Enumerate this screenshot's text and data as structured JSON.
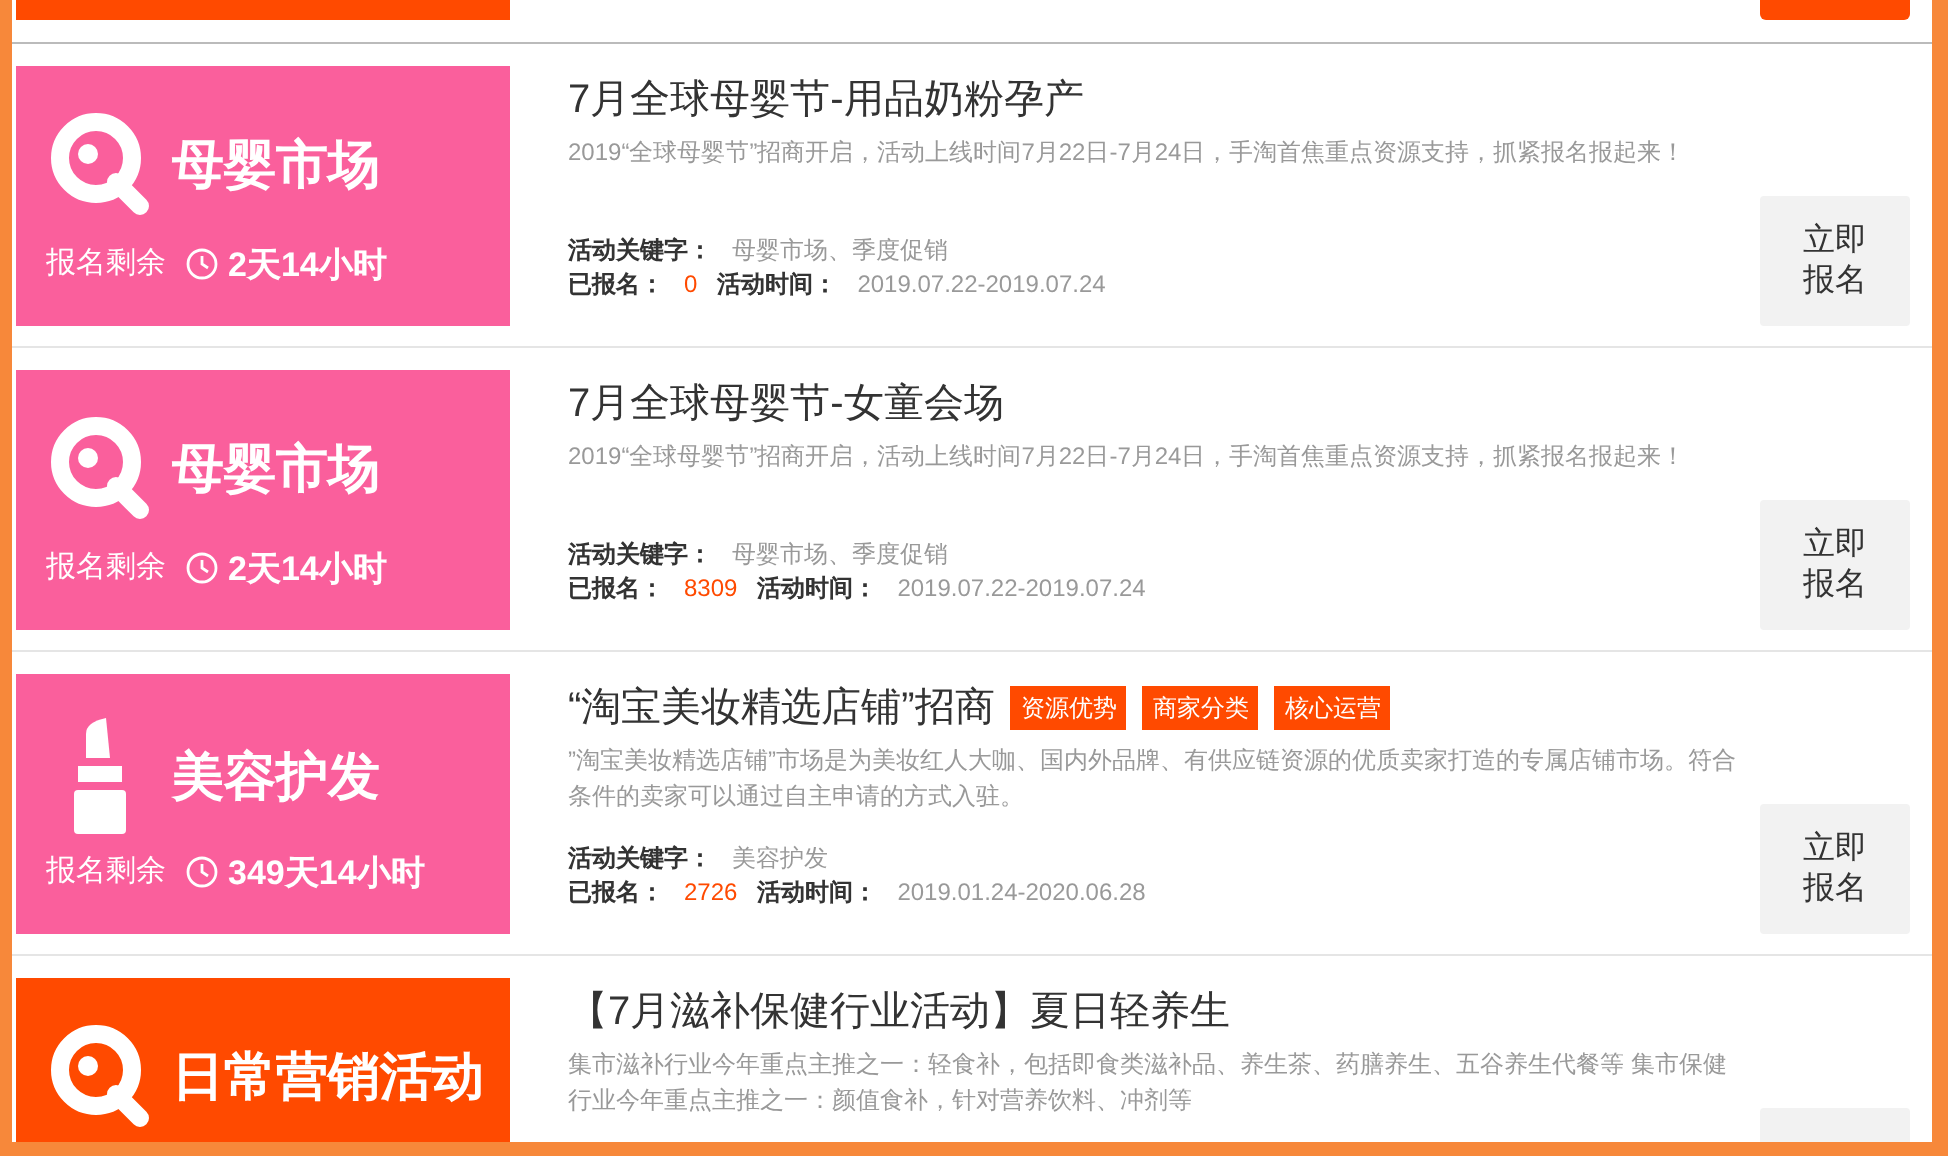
{
  "cards": [
    {
      "banner": {
        "kind": "search",
        "color": "#fa5f9c",
        "label": "母婴市场",
        "countdown_label": "报名剩余",
        "countdown": "2天14小时"
      },
      "title": "7月全球母婴节-用品奶粉孕产",
      "description": "2019“全球母婴节”招商开启，活动上线时间7月22日-7月24日，手淘首焦重点资源支持，抓紧报名报起来！",
      "keywords_label": "活动关键字：",
      "keywords": "母婴市场、季度促销",
      "registered_label": "已报名：",
      "registered": "0",
      "time_label": "活动时间：",
      "time": "2019.07.22-2019.07.24",
      "button": "立即报名"
    },
    {
      "banner": {
        "kind": "search",
        "color": "#fa5f9c",
        "label": "母婴市场",
        "countdown_label": "报名剩余",
        "countdown": "2天14小时"
      },
      "title": "7月全球母婴节-女童会场",
      "description": "2019“全球母婴节”招商开启，活动上线时间7月22日-7月24日，手淘首焦重点资源支持，抓紧报名报起来！",
      "keywords_label": "活动关键字：",
      "keywords": "母婴市场、季度促销",
      "registered_label": "已报名：",
      "registered": "8309",
      "time_label": "活动时间：",
      "time": "2019.07.22-2019.07.24",
      "button": "立即报名"
    },
    {
      "banner": {
        "kind": "lipstick",
        "color": "#fa5f9c",
        "label": "美容护发",
        "countdown_label": "报名剩余",
        "countdown": "349天14小时"
      },
      "title": "“淘宝美妆精选店铺”招商",
      "tags": [
        "资源优势",
        "商家分类",
        "核心运营"
      ],
      "description": "”淘宝美妆精选店铺”市场是为美妆红人大咖、国内外品牌、有供应链资源的优质卖家打造的专属店铺市场。符合条件的卖家可以通过自主申请的方式入驻。",
      "keywords_label": "活动关键字：",
      "keywords": "美容护发",
      "registered_label": "已报名：",
      "registered": "2726",
      "time_label": "活动时间：",
      "time": "2019.01.24-2020.06.28",
      "button": "立即报名"
    },
    {
      "banner": {
        "kind": "search",
        "color": "#ff4a00",
        "label": "日常营销活动"
      },
      "title": "【7月滋补保健行业活动】夏日轻养生",
      "description": "集市滋补行业今年重点主推之一：轻食补，包括即食类滋补品、养生茶、药膳养生、五谷养生代餐等 集市保健行业今年重点主推之一：颜值食补，针对营养饮料、冲剂等"
    }
  ]
}
